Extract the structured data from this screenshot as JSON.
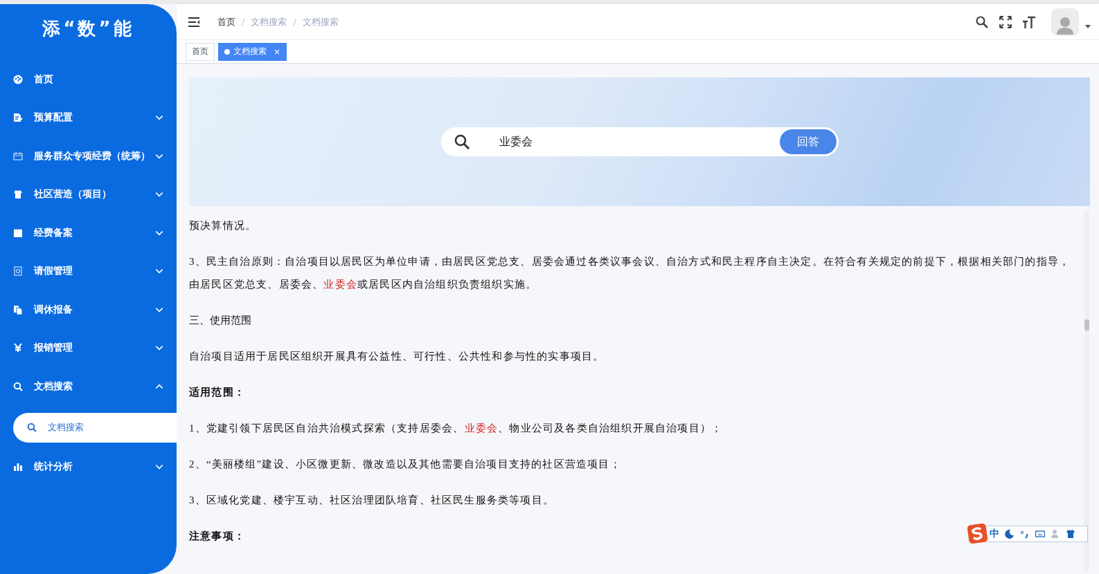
{
  "sidebar": {
    "logo": "添“数”能",
    "items": [
      {
        "label": "首页",
        "kind": "link"
      },
      {
        "label": "预算配置",
        "kind": "group",
        "expanded": false
      },
      {
        "label": "服务群众专项经费（统筹）",
        "kind": "group",
        "expanded": false
      },
      {
        "label": "社区营造（项目）",
        "kind": "group",
        "expanded": false
      },
      {
        "label": "经费备案",
        "kind": "group",
        "expanded": false
      },
      {
        "label": "请假管理",
        "kind": "group",
        "expanded": false
      },
      {
        "label": "调休报备",
        "kind": "group",
        "expanded": false
      },
      {
        "label": "报销管理",
        "kind": "group",
        "expanded": false
      },
      {
        "label": "文档搜索",
        "kind": "group",
        "expanded": true,
        "children": [
          {
            "label": "文档搜索",
            "selected": true
          }
        ]
      },
      {
        "label": "统计分析",
        "kind": "group",
        "expanded": false
      }
    ]
  },
  "breadcrumb": [
    {
      "label": "首页"
    },
    {
      "separator": "/",
      "label": "文档搜索"
    },
    {
      "separator": "/",
      "label": "文档搜索"
    }
  ],
  "tabs": [
    {
      "label": "首页",
      "selected": false
    },
    {
      "label": "文档搜索",
      "selected": true,
      "close": "×"
    }
  ],
  "search": {
    "value": "业委会",
    "button": "回答"
  },
  "paragraphs": [
    {
      "kind": "text",
      "runs": [
        {
          "text": "预决算情况。",
          "highlight": false
        }
      ]
    },
    {
      "kind": "text",
      "runs": [
        {
          "text": "3、民主自治原则：自治项目以居民区为单位申请，由居民区党总支、居委会通过各类议事会议、自治方式和民主程序自主决定。在符合有关规定的前提下，根据相关部门的指导，由居民区党总支、居委会、",
          "highlight": false
        },
        {
          "text": "业委会",
          "highlight": true
        },
        {
          "text": "或居民区内自治组织负责组织实施。",
          "highlight": false
        }
      ]
    },
    {
      "kind": "heading",
      "runs": [
        {
          "text": "三、使用范围",
          "highlight": false
        }
      ]
    },
    {
      "kind": "text",
      "runs": [
        {
          "text": "自治项目适用于居民区组织开展具有公益性、可行性、公共性和参与性的实事项目。",
          "highlight": false
        }
      ]
    },
    {
      "kind": "bold",
      "runs": [
        {
          "text": "适用范围：",
          "highlight": false
        }
      ]
    },
    {
      "kind": "text",
      "runs": [
        {
          "text": "1、党建引领下居民区自治共治模式探索（支持居委会、",
          "highlight": false
        },
        {
          "text": "业委会",
          "highlight": true
        },
        {
          "text": "、物业公司及各类自治组织开展自治项目）；",
          "highlight": false
        }
      ]
    },
    {
      "kind": "text",
      "runs": [
        {
          "text": "2、“美丽楼组”建设、小区微更新、微改造以及其他需要自治项目支持的社区营造项目；",
          "highlight": false
        }
      ]
    },
    {
      "kind": "text",
      "runs": [
        {
          "text": "3、区域化党建、楼宇互动、社区治理团队培育、社区民生服务类等项目。",
          "highlight": false
        }
      ]
    },
    {
      "kind": "bold",
      "runs": [
        {
          "text": "注意事项：",
          "highlight": false
        }
      ]
    }
  ],
  "ime": {
    "mode": "中"
  }
}
